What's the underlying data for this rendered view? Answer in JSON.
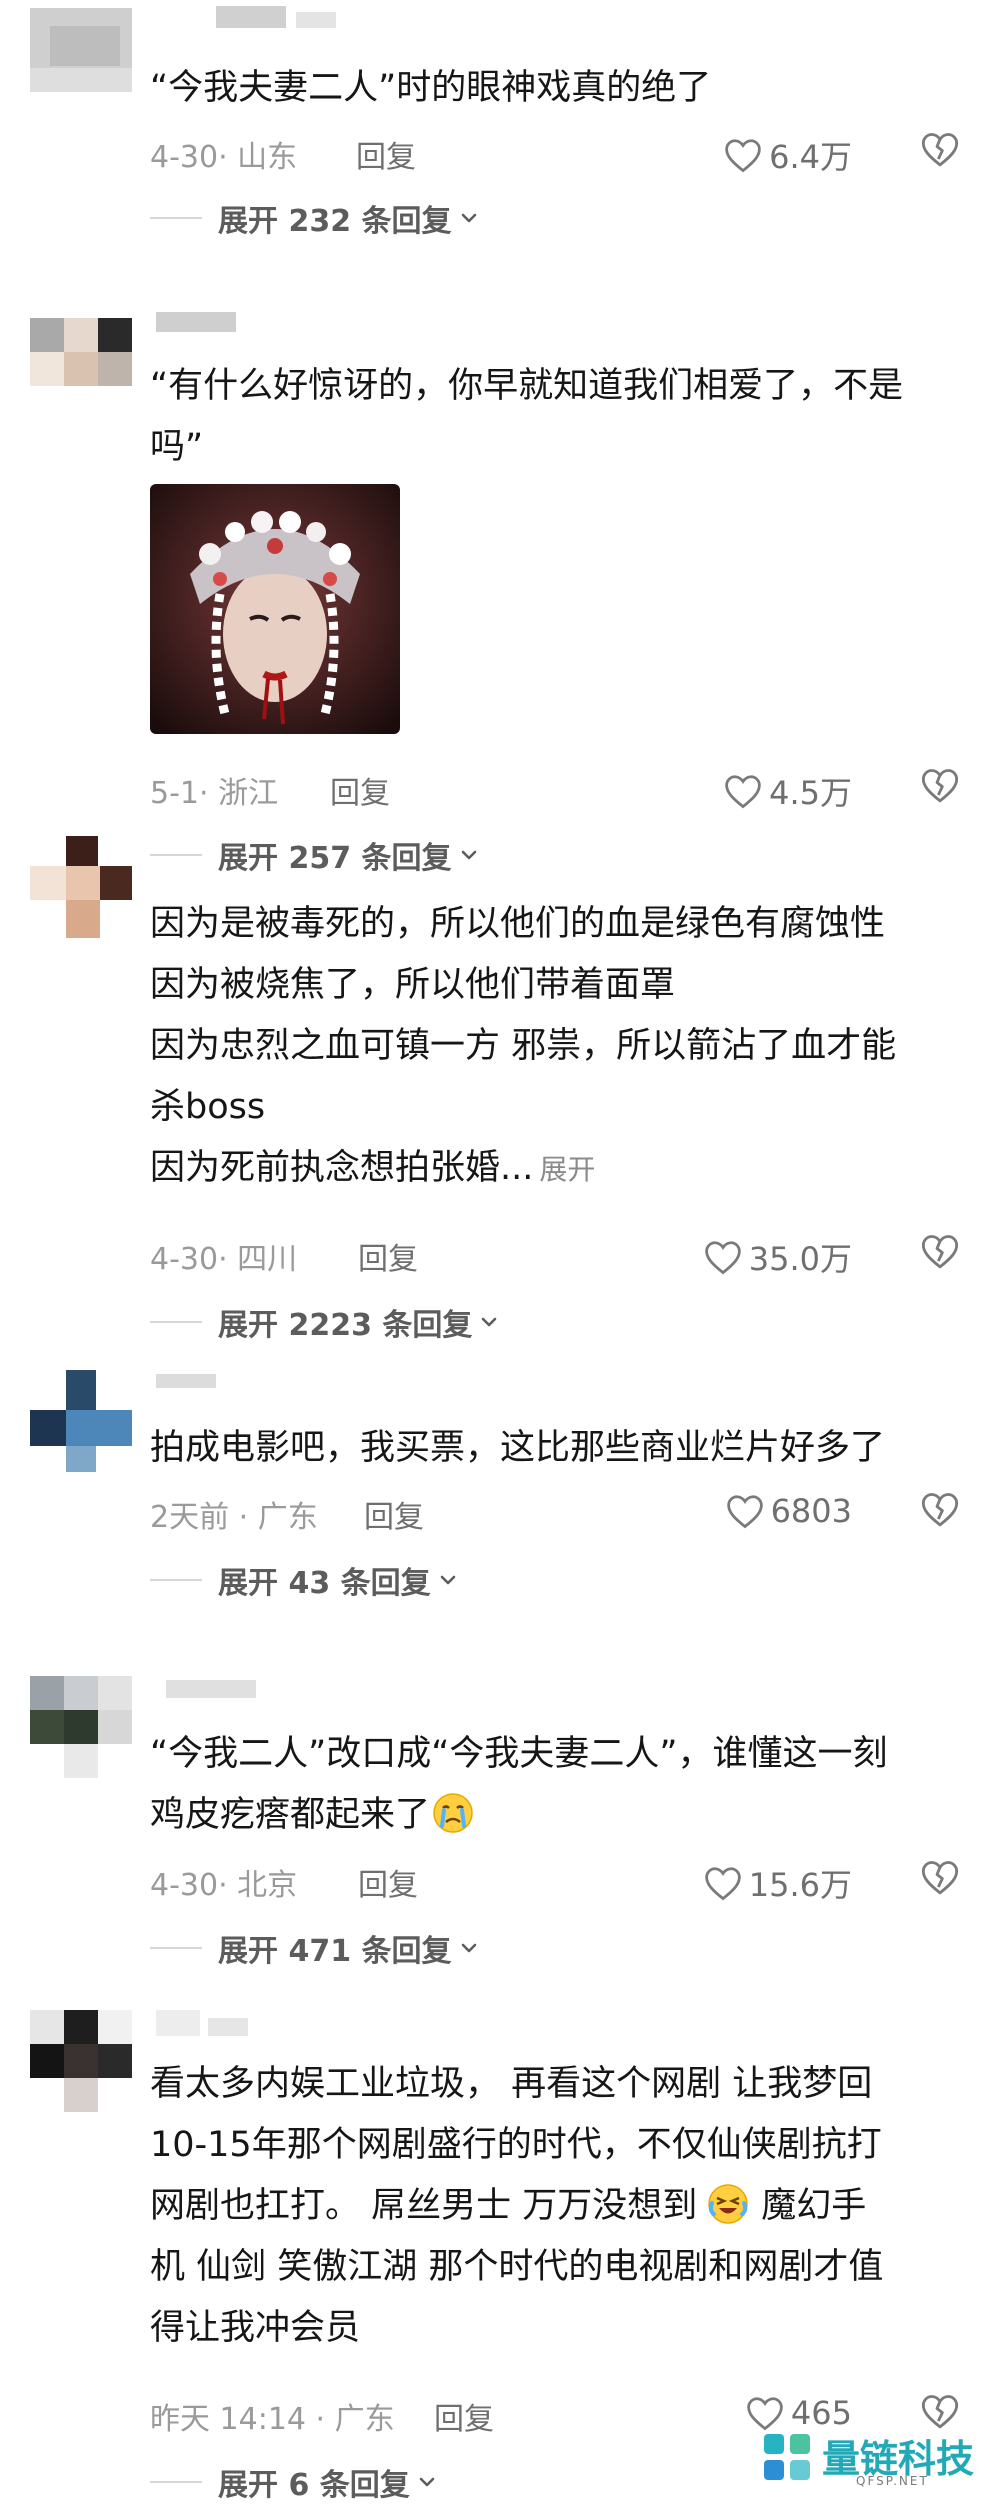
{
  "comments": [
    {
      "lines": [
        "“今我夫妻二人”时的眼神戏真的绝了"
      ],
      "date": "4-30· 山东",
      "reply": "回复",
      "likes": "6.4万",
      "expand": "展开 232 条回复"
    },
    {
      "lines": [
        "“有什么好惊讶的，你早就知道我们相爱了，不是",
        "吗”"
      ],
      "date": "5-1· 浙江",
      "reply": "回复",
      "likes": "4.5万",
      "expand": "展开 257 条回复"
    },
    {
      "lines": [
        "因为是被毒死的，所以他们的血是绿色有腐蚀性",
        "因为被烧焦了，所以他们带着面罩",
        "因为忠烈之血可镇一方 邪祟，所以箭沾了血才能",
        "杀boss",
        "因为死前执念想拍张婚..."
      ],
      "inline_expand": "展开",
      "date": "4-30· 四川",
      "reply": "回复",
      "likes": "35.0万",
      "expand": "展开 2223 条回复"
    },
    {
      "lines": [
        "拍成电影吧，我买票，这比那些商业烂片好多了"
      ],
      "date": "2天前 · 广东",
      "reply": "回复",
      "likes": "6803",
      "expand": "展开 43 条回复"
    },
    {
      "lines": [
        "“今我二人”改口成“今我夫妻二人”，谁懂这一刻",
        "鸡皮疙瘩都起来了"
      ],
      "date": "4-30· 北京",
      "reply": "回复",
      "likes": "15.6万",
      "expand": "展开 471 条回复"
    },
    {
      "lines": [
        "看太多内娱工业垃圾， 再看这个网剧 让我梦回",
        "10-15年那个网剧盛行的时代，不仅仙侠剧抗打",
        "网剧也扛打。 屌丝男士  万万没想到",
        "机 仙剑  笑傲江湖 那个时代的电视剧和网剧才值",
        "得让我冲会员"
      ],
      "line3_tail": "魔幻手",
      "date": "昨天 14:14 · 广东",
      "reply": "回复",
      "likes": "465",
      "expand": "展开 6 条回复"
    }
  ],
  "icons": {
    "like": "heart-outline-icon",
    "dislike": "broken-heart-icon",
    "expand": "chevron-down-icon",
    "emoji": "crying-face-emoji-icon"
  },
  "watermark": {
    "text": "量链科技",
    "sub": "QFSP.NET"
  },
  "colors": {
    "text": "#161616",
    "meta": "#9a9a9a",
    "watermark": "#21a9b8"
  }
}
